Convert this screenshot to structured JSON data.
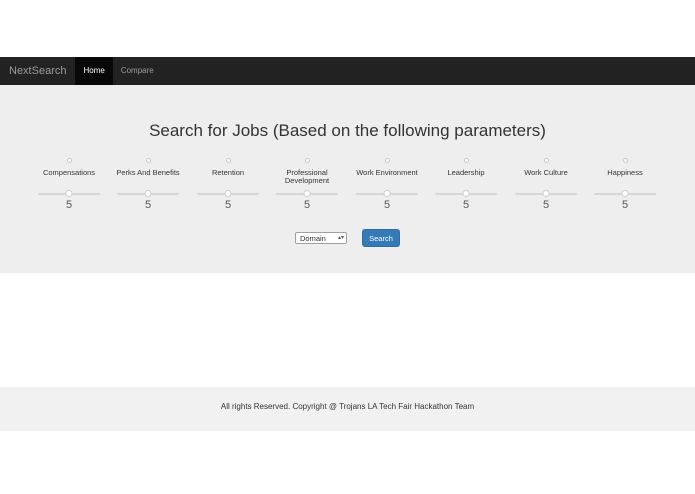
{
  "navbar": {
    "brand": "NextSearch",
    "links": [
      {
        "label": "Home",
        "active": true
      },
      {
        "label": "Compare",
        "active": false
      }
    ]
  },
  "main": {
    "title": "Search for Jobs (Based on the following parameters)",
    "parameters": [
      {
        "label": "Compensations",
        "value": "5",
        "slider_fraction": 0.5
      },
      {
        "label": "Perks And Benefits",
        "value": "5",
        "slider_fraction": 0.5
      },
      {
        "label": "Retention",
        "value": "5",
        "slider_fraction": 0.5
      },
      {
        "label": "Professional Development",
        "value": "5",
        "slider_fraction": 0.5
      },
      {
        "label": "Work Environment",
        "value": "5",
        "slider_fraction": 0.5
      },
      {
        "label": "Leadership",
        "value": "5",
        "slider_fraction": 0.5
      },
      {
        "label": "Work Culture",
        "value": "5",
        "slider_fraction": 0.5
      },
      {
        "label": "Happiness",
        "value": "5",
        "slider_fraction": 0.5
      }
    ],
    "domain_select": {
      "selected": "Domain"
    },
    "search_button": "Search"
  },
  "footer": {
    "text": "All rights Reserved. Copyright @ Trojans LA Tech Fair Hackathon Team"
  },
  "colors": {
    "navbar_bg": "#222222",
    "jumbotron_bg": "#eeeeee",
    "primary": "#337ab7",
    "footer_bg": "#f1f1f1"
  }
}
